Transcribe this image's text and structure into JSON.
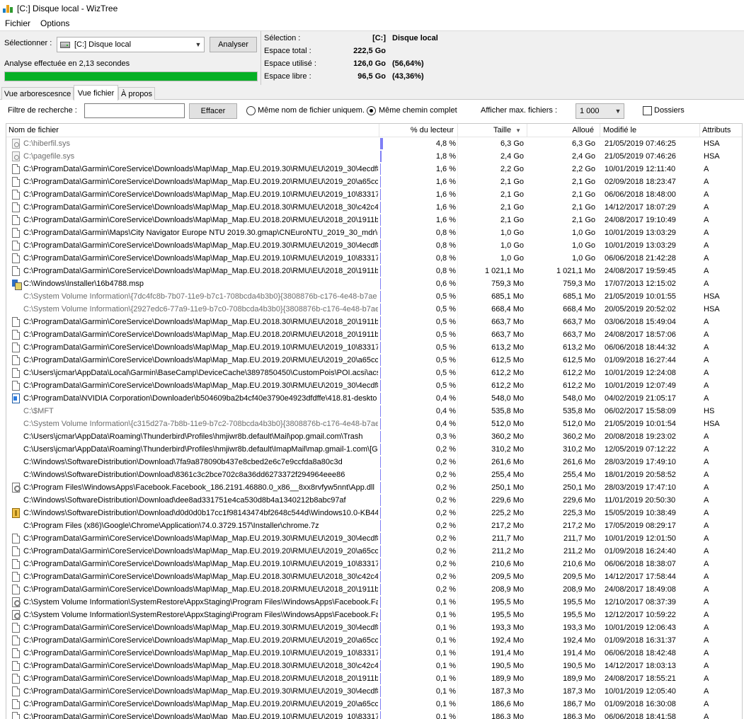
{
  "window": {
    "title": "[C:] Disque local  - WizTree"
  },
  "menu": [
    "Fichier",
    "Options"
  ],
  "top": {
    "select_label": "Sélectionner :",
    "drive_value": "[C:] Disque local",
    "analyze_label": "Analyser",
    "status": "Analyse effectuée en 2,13 secondes",
    "progress_percent": 100
  },
  "info": {
    "selection_label": "Sélection :",
    "selection_drive": "[C:]",
    "selection_name": "Disque local",
    "total_label": "Espace total :",
    "total_value": "222,5 Go",
    "used_label": "Espace utilisé :",
    "used_value": "126,0 Go",
    "used_pct": "(56,64%)",
    "free_label": "Espace libre :",
    "free_value": "96,5 Go",
    "free_pct": "(43,36%)"
  },
  "tabs": [
    "Vue arborescesnce",
    "Vue fichier",
    "À propos"
  ],
  "filter": {
    "label": "Filtre de recherche :",
    "input_value": "",
    "button": "Effacer",
    "radio1": "Même nom de fichier uniquem.",
    "radio2": "Même chemin complet",
    "max_label": "Afficher max. fichiers :",
    "max_value": "1 000",
    "folders_label": "Dossiers"
  },
  "columns": {
    "name": "Nom de fichier",
    "pct": "% du lecteur",
    "size": "Taille",
    "alloc": "Alloué",
    "modified": "Modifié le",
    "attrs": "Attributs"
  },
  "colors": {
    "progress": "#06b025",
    "pct_bar": "#7f7ff5",
    "system_text": "#6d6d6d"
  },
  "rows": [
    {
      "icon": "sys",
      "gray": true,
      "name": "C:\\hiberfil.sys",
      "pct": "4,8 %",
      "pv": 4.8,
      "size": "6,3 Go",
      "alloc": "6,3 Go",
      "mod": "21/05/2019 07:46:25",
      "attr": "HSA"
    },
    {
      "icon": "sys",
      "gray": true,
      "name": "C:\\pagefile.sys",
      "pct": "1,8 %",
      "pv": 1.8,
      "size": "2,4 Go",
      "alloc": "2,4 Go",
      "mod": "21/05/2019 07:46:26",
      "attr": "HSA"
    },
    {
      "icon": "doc",
      "name": "C:\\ProgramData\\Garmin\\CoreService\\Downloads\\Map\\Map_Map.EU.2019.30\\RMU\\EU\\2019_30\\4ecdf8c",
      "pct": "1,6 %",
      "pv": 1.6,
      "size": "2,2 Go",
      "alloc": "2,2 Go",
      "mod": "10/01/2019 12:11:40",
      "attr": "A"
    },
    {
      "icon": "doc",
      "name": "C:\\ProgramData\\Garmin\\CoreService\\Downloads\\Map\\Map_Map.EU.2019.20\\RMU\\EU\\2019_20\\a65cc0",
      "pct": "1,6 %",
      "pv": 1.6,
      "size": "2,1 Go",
      "alloc": "2,1 Go",
      "mod": "02/09/2018 18:23:47",
      "attr": "A"
    },
    {
      "icon": "doc",
      "name": "C:\\ProgramData\\Garmin\\CoreService\\Downloads\\Map\\Map_Map.EU.2019.10\\RMU\\EU\\2019_10\\833177",
      "pct": "1,6 %",
      "pv": 1.6,
      "size": "2,1 Go",
      "alloc": "2,1 Go",
      "mod": "06/06/2018 18:48:00",
      "attr": "A"
    },
    {
      "icon": "doc",
      "name": "C:\\ProgramData\\Garmin\\CoreService\\Downloads\\Map\\Map_Map.EU.2018.30\\RMU\\EU\\2018_30\\c42c4e",
      "pct": "1,6 %",
      "pv": 1.6,
      "size": "2,1 Go",
      "alloc": "2,1 Go",
      "mod": "14/12/2017 18:07:29",
      "attr": "A"
    },
    {
      "icon": "doc",
      "name": "C:\\ProgramData\\Garmin\\CoreService\\Downloads\\Map\\Map_Map.EU.2018.20\\RMU\\EU\\2018_20\\1911b7",
      "pct": "1,6 %",
      "pv": 1.6,
      "size": "2,1 Go",
      "alloc": "2,1 Go",
      "mod": "24/08/2017 19:10:49",
      "attr": "A"
    },
    {
      "icon": "doc",
      "name": "C:\\ProgramData\\Garmin\\Maps\\City Navigator Europe NTU 2019.30.gmap\\CNEuroNTU_2019_30_mdr\\CN",
      "pct": "0,8 %",
      "pv": 0.8,
      "size": "1,0 Go",
      "alloc": "1,0 Go",
      "mod": "10/01/2019 13:03:29",
      "attr": "A"
    },
    {
      "icon": "doc",
      "name": "C:\\ProgramData\\Garmin\\CoreService\\Downloads\\Map\\Map_Map.EU.2019.30\\RMU\\EU\\2019_30\\4ecdf8c",
      "pct": "0,8 %",
      "pv": 0.8,
      "size": "1,0 Go",
      "alloc": "1,0 Go",
      "mod": "10/01/2019 13:03:29",
      "attr": "A"
    },
    {
      "icon": "doc",
      "name": "C:\\ProgramData\\Garmin\\CoreService\\Downloads\\Map\\Map_Map.EU.2019.10\\RMU\\EU\\2019_10\\833177",
      "pct": "0,8 %",
      "pv": 0.8,
      "size": "1,0 Go",
      "alloc": "1,0 Go",
      "mod": "06/06/2018 21:42:28",
      "attr": "A"
    },
    {
      "icon": "doc",
      "name": "C:\\ProgramData\\Garmin\\CoreService\\Downloads\\Map\\Map_Map.EU.2018.20\\RMU\\EU\\2018_20\\1911b7",
      "pct": "0,8 %",
      "pv": 0.8,
      "size": "1 021,1 Mo",
      "alloc": "1 021,1 Mo",
      "mod": "24/08/2017 19:59:45",
      "attr": "A"
    },
    {
      "icon": "msi",
      "name": "C:\\Windows\\Installer\\16b4788.msp",
      "pct": "0,6 %",
      "pv": 0.6,
      "size": "759,3 Mo",
      "alloc": "759,3 Mo",
      "mod": "17/07/2013 12:15:02",
      "attr": "A"
    },
    {
      "icon": "none",
      "gray": true,
      "name": "C:\\System Volume Information\\{7dc4fc8b-7b07-11e9-b7c1-708bcda4b3b0}{3808876b-c176-4e48-b7ae",
      "pct": "0,5 %",
      "pv": 0.5,
      "size": "685,1 Mo",
      "alloc": "685,1 Mo",
      "mod": "21/05/2019 10:01:55",
      "attr": "HSA"
    },
    {
      "icon": "none",
      "gray": true,
      "name": "C:\\System Volume Information\\{2927edc6-77a9-11e9-b7c0-708bcda4b3b0}{3808876b-c176-4e48-b7ae",
      "pct": "0,5 %",
      "pv": 0.5,
      "size": "668,4 Mo",
      "alloc": "668,4 Mo",
      "mod": "20/05/2019 20:52:02",
      "attr": "HSA"
    },
    {
      "icon": "doc",
      "name": "C:\\ProgramData\\Garmin\\CoreService\\Downloads\\Map\\Map_Map.EU.2018.30\\RMU\\EU\\2018_20\\1911b7",
      "pct": "0,5 %",
      "pv": 0.5,
      "size": "663,7 Mo",
      "alloc": "663,7 Mo",
      "mod": "03/06/2018 15:49:04",
      "attr": "A"
    },
    {
      "icon": "doc",
      "name": "C:\\ProgramData\\Garmin\\CoreService\\Downloads\\Map\\Map_Map.EU.2018.20\\RMU\\EU\\2018_20\\1911b7",
      "pct": "0,5 %",
      "pv": 0.5,
      "size": "663,7 Mo",
      "alloc": "663,7 Mo",
      "mod": "24/08/2017 18:57:06",
      "attr": "A"
    },
    {
      "icon": "doc",
      "name": "C:\\ProgramData\\Garmin\\CoreService\\Downloads\\Map\\Map_Map.EU.2019.10\\RMU\\EU\\2019_10\\833177",
      "pct": "0,5 %",
      "pv": 0.5,
      "size": "613,2 Mo",
      "alloc": "613,2 Mo",
      "mod": "06/06/2018 18:44:32",
      "attr": "A"
    },
    {
      "icon": "doc",
      "name": "C:\\ProgramData\\Garmin\\CoreService\\Downloads\\Map\\Map_Map.EU.2019.20\\RMU\\EU\\2019_20\\a65cc0",
      "pct": "0,5 %",
      "pv": 0.5,
      "size": "612,5 Mo",
      "alloc": "612,5 Mo",
      "mod": "01/09/2018 16:27:44",
      "attr": "A"
    },
    {
      "icon": "doc",
      "name": "C:\\Users\\jcmar\\AppData\\Local\\Garmin\\BaseCamp\\DeviceCache\\3897850450\\CustomPois\\POI.acsi\\acsi.",
      "pct": "0,5 %",
      "pv": 0.5,
      "size": "612,2 Mo",
      "alloc": "612,2 Mo",
      "mod": "10/01/2019 12:24:08",
      "attr": "A"
    },
    {
      "icon": "doc",
      "name": "C:\\ProgramData\\Garmin\\CoreService\\Downloads\\Map\\Map_Map.EU.2019.30\\RMU\\EU\\2019_30\\4ecdf8c",
      "pct": "0,5 %",
      "pv": 0.5,
      "size": "612,2 Mo",
      "alloc": "612,2 Mo",
      "mod": "10/01/2019 12:07:49",
      "attr": "A"
    },
    {
      "icon": "exe",
      "name": "C:\\ProgramData\\NVIDIA Corporation\\Downloader\\b504609ba2b4cf40e3790e4923dfdffe\\418.81-deskto",
      "pct": "0,4 %",
      "pv": 0.4,
      "size": "548,0 Mo",
      "alloc": "548,0 Mo",
      "mod": "04/02/2019 21:05:17",
      "attr": "A"
    },
    {
      "icon": "none",
      "gray": true,
      "name": "C:\\$MFT",
      "pct": "0,4 %",
      "pv": 0.4,
      "size": "535,8 Mo",
      "alloc": "535,8 Mo",
      "mod": "06/02/2017 15:58:09",
      "attr": "HS"
    },
    {
      "icon": "none",
      "gray": true,
      "name": "C:\\System Volume Information\\{c315d27a-7b8b-11e9-b7c2-708bcda4b3b0}{3808876b-c176-4e48-b7ae",
      "pct": "0,4 %",
      "pv": 0.4,
      "size": "512,0 Mo",
      "alloc": "512,0 Mo",
      "mod": "21/05/2019 10:01:54",
      "attr": "HSA"
    },
    {
      "icon": "none",
      "name": "C:\\Users\\jcmar\\AppData\\Roaming\\Thunderbird\\Profiles\\hmjiwr8b.default\\Mail\\pop.gmail.com\\Trash",
      "pct": "0,3 %",
      "pv": 0.3,
      "size": "360,2 Mo",
      "alloc": "360,2 Mo",
      "mod": "20/08/2018 19:23:02",
      "attr": "A"
    },
    {
      "icon": "none",
      "name": "C:\\Users\\jcmar\\AppData\\Roaming\\Thunderbird\\Profiles\\hmjiwr8b.default\\ImapMail\\map.gmail-1.com\\[G",
      "pct": "0,2 %",
      "pv": 0.2,
      "size": "310,2 Mo",
      "alloc": "310,2 Mo",
      "mod": "12/05/2019 07:12:22",
      "attr": "A"
    },
    {
      "icon": "none",
      "name": "C:\\Windows\\SoftwareDistribution\\Download\\7fa9a878090b437e8cbed2e6c7e9ccfda8a80c3d",
      "pct": "0,2 %",
      "pv": 0.2,
      "size": "261,6 Mo",
      "alloc": "261,6 Mo",
      "mod": "28/03/2019 17:49:10",
      "attr": "A"
    },
    {
      "icon": "none",
      "name": "C:\\Windows\\SoftwareDistribution\\Download\\8361c3c2bce702c8a36dd6273372f294964eee86",
      "pct": "0,2 %",
      "pv": 0.2,
      "size": "255,4 Mo",
      "alloc": "255,4 Mo",
      "mod": "18/01/2019 20:58:52",
      "attr": "A"
    },
    {
      "icon": "gear",
      "name": "C:\\Program Files\\WindowsApps\\Facebook.Facebook_186.2191.46880.0_x86__8xx8rvfyw5nnt\\App.dll",
      "pct": "0,2 %",
      "pv": 0.2,
      "size": "250,1 Mo",
      "alloc": "250,1 Mo",
      "mod": "28/03/2019 17:47:10",
      "attr": "A"
    },
    {
      "icon": "none",
      "name": "C:\\Windows\\SoftwareDistribution\\Download\\dee8ad331751e4ca530d8b4a1340212b8abc97af",
      "pct": "0,2 %",
      "pv": 0.2,
      "size": "229,6 Mo",
      "alloc": "229,6 Mo",
      "mod": "11/01/2019 20:50:30",
      "attr": "A"
    },
    {
      "icon": "cab",
      "name": "C:\\Windows\\SoftwareDistribution\\Download\\d0d0d0b17cc1f98143474bf2648c544d\\Windows10.0-KB44",
      "pct": "0,2 %",
      "pv": 0.2,
      "size": "225,2 Mo",
      "alloc": "225,3 Mo",
      "mod": "15/05/2019 10:38:49",
      "attr": "A"
    },
    {
      "icon": "none",
      "name": "C:\\Program Files (x86)\\Google\\Chrome\\Application\\74.0.3729.157\\Installer\\chrome.7z",
      "pct": "0,2 %",
      "pv": 0.2,
      "size": "217,2 Mo",
      "alloc": "217,2 Mo",
      "mod": "17/05/2019 08:29:17",
      "attr": "A"
    },
    {
      "icon": "doc",
      "name": "C:\\ProgramData\\Garmin\\CoreService\\Downloads\\Map\\Map_Map.EU.2019.30\\RMU\\EU\\2019_30\\4ecdf8c",
      "pct": "0,2 %",
      "pv": 0.2,
      "size": "211,7 Mo",
      "alloc": "211,7 Mo",
      "mod": "10/01/2019 12:01:50",
      "attr": "A"
    },
    {
      "icon": "doc",
      "name": "C:\\ProgramData\\Garmin\\CoreService\\Downloads\\Map\\Map_Map.EU.2019.20\\RMU\\EU\\2019_20\\a65cc0",
      "pct": "0,2 %",
      "pv": 0.2,
      "size": "211,2 Mo",
      "alloc": "211,2 Mo",
      "mod": "01/09/2018 16:24:40",
      "attr": "A"
    },
    {
      "icon": "doc",
      "name": "C:\\ProgramData\\Garmin\\CoreService\\Downloads\\Map\\Map_Map.EU.2019.10\\RMU\\EU\\2019_10\\833177",
      "pct": "0,2 %",
      "pv": 0.2,
      "size": "210,6 Mo",
      "alloc": "210,6 Mo",
      "mod": "06/06/2018 18:38:07",
      "attr": "A"
    },
    {
      "icon": "doc",
      "name": "C:\\ProgramData\\Garmin\\CoreService\\Downloads\\Map\\Map_Map.EU.2018.30\\RMU\\EU\\2018_30\\c42c4e",
      "pct": "0,2 %",
      "pv": 0.2,
      "size": "209,5 Mo",
      "alloc": "209,5 Mo",
      "mod": "14/12/2017 17:58:44",
      "attr": "A"
    },
    {
      "icon": "doc",
      "name": "C:\\ProgramData\\Garmin\\CoreService\\Downloads\\Map\\Map_Map.EU.2018.20\\RMU\\EU\\2018_20\\1911b7",
      "pct": "0,2 %",
      "pv": 0.2,
      "size": "208,9 Mo",
      "alloc": "208,9 Mo",
      "mod": "24/08/2017 18:49:08",
      "attr": "A"
    },
    {
      "icon": "gear",
      "name": "C:\\System Volume Information\\SystemRestore\\AppxStaging\\Program Files\\WindowsApps\\Facebook.Fac",
      "pct": "0,1 %",
      "pv": 0.1,
      "size": "195,5 Mo",
      "alloc": "195,5 Mo",
      "mod": "12/10/2017 08:37:39",
      "attr": "A"
    },
    {
      "icon": "gear",
      "name": "C:\\System Volume Information\\SystemRestore\\AppxStaging\\Program Files\\WindowsApps\\Facebook.Fac",
      "pct": "0,1 %",
      "pv": 0.1,
      "size": "195,5 Mo",
      "alloc": "195,5 Mo",
      "mod": "12/12/2017 10:59:22",
      "attr": "A"
    },
    {
      "icon": "doc",
      "name": "C:\\ProgramData\\Garmin\\CoreService\\Downloads\\Map\\Map_Map.EU.2019.30\\RMU\\EU\\2019_30\\4ecdf8c",
      "pct": "0,1 %",
      "pv": 0.1,
      "size": "193,3 Mo",
      "alloc": "193,3 Mo",
      "mod": "10/01/2019 12:06:43",
      "attr": "A"
    },
    {
      "icon": "doc",
      "name": "C:\\ProgramData\\Garmin\\CoreService\\Downloads\\Map\\Map_Map.EU.2019.20\\RMU\\EU\\2019_20\\a65cc0",
      "pct": "0,1 %",
      "pv": 0.1,
      "size": "192,4 Mo",
      "alloc": "192,4 Mo",
      "mod": "01/09/2018 16:31:37",
      "attr": "A"
    },
    {
      "icon": "doc",
      "name": "C:\\ProgramData\\Garmin\\CoreService\\Downloads\\Map\\Map_Map.EU.2019.10\\RMU\\EU\\2019_10\\833177",
      "pct": "0,1 %",
      "pv": 0.1,
      "size": "191,4 Mo",
      "alloc": "191,4 Mo",
      "mod": "06/06/2018 18:42:48",
      "attr": "A"
    },
    {
      "icon": "doc",
      "name": "C:\\ProgramData\\Garmin\\CoreService\\Downloads\\Map\\Map_Map.EU.2018.30\\RMU\\EU\\2018_30\\c42c4e",
      "pct": "0,1 %",
      "pv": 0.1,
      "size": "190,5 Mo",
      "alloc": "190,5 Mo",
      "mod": "14/12/2017 18:03:13",
      "attr": "A"
    },
    {
      "icon": "doc",
      "name": "C:\\ProgramData\\Garmin\\CoreService\\Downloads\\Map\\Map_Map.EU.2018.20\\RMU\\EU\\2018_20\\1911b7",
      "pct": "0,1 %",
      "pv": 0.1,
      "size": "189,9 Mo",
      "alloc": "189,9 Mo",
      "mod": "24/08/2017 18:55:21",
      "attr": "A"
    },
    {
      "icon": "doc",
      "name": "C:\\ProgramData\\Garmin\\CoreService\\Downloads\\Map\\Map_Map.EU.2019.30\\RMU\\EU\\2019_30\\4ecdf8c",
      "pct": "0,1 %",
      "pv": 0.1,
      "size": "187,3 Mo",
      "alloc": "187,3 Mo",
      "mod": "10/01/2019 12:05:40",
      "attr": "A"
    },
    {
      "icon": "doc",
      "name": "C:\\ProgramData\\Garmin\\CoreService\\Downloads\\Map\\Map_Map.EU.2019.20\\RMU\\EU\\2019_20\\a65cc0",
      "pct": "0,1 %",
      "pv": 0.1,
      "size": "186,6 Mo",
      "alloc": "186,7 Mo",
      "mod": "01/09/2018 16:30:08",
      "attr": "A"
    },
    {
      "icon": "doc",
      "name": "C:\\ProgramData\\Garmin\\CoreService\\Downloads\\Map\\Map_Map.EU.2019.10\\RMU\\EU\\2019_10\\833177",
      "pct": "0,1 %",
      "pv": 0.1,
      "size": "186,3 Mo",
      "alloc": "186,3 Mo",
      "mod": "06/06/2018 18:41:58",
      "attr": "A"
    }
  ]
}
